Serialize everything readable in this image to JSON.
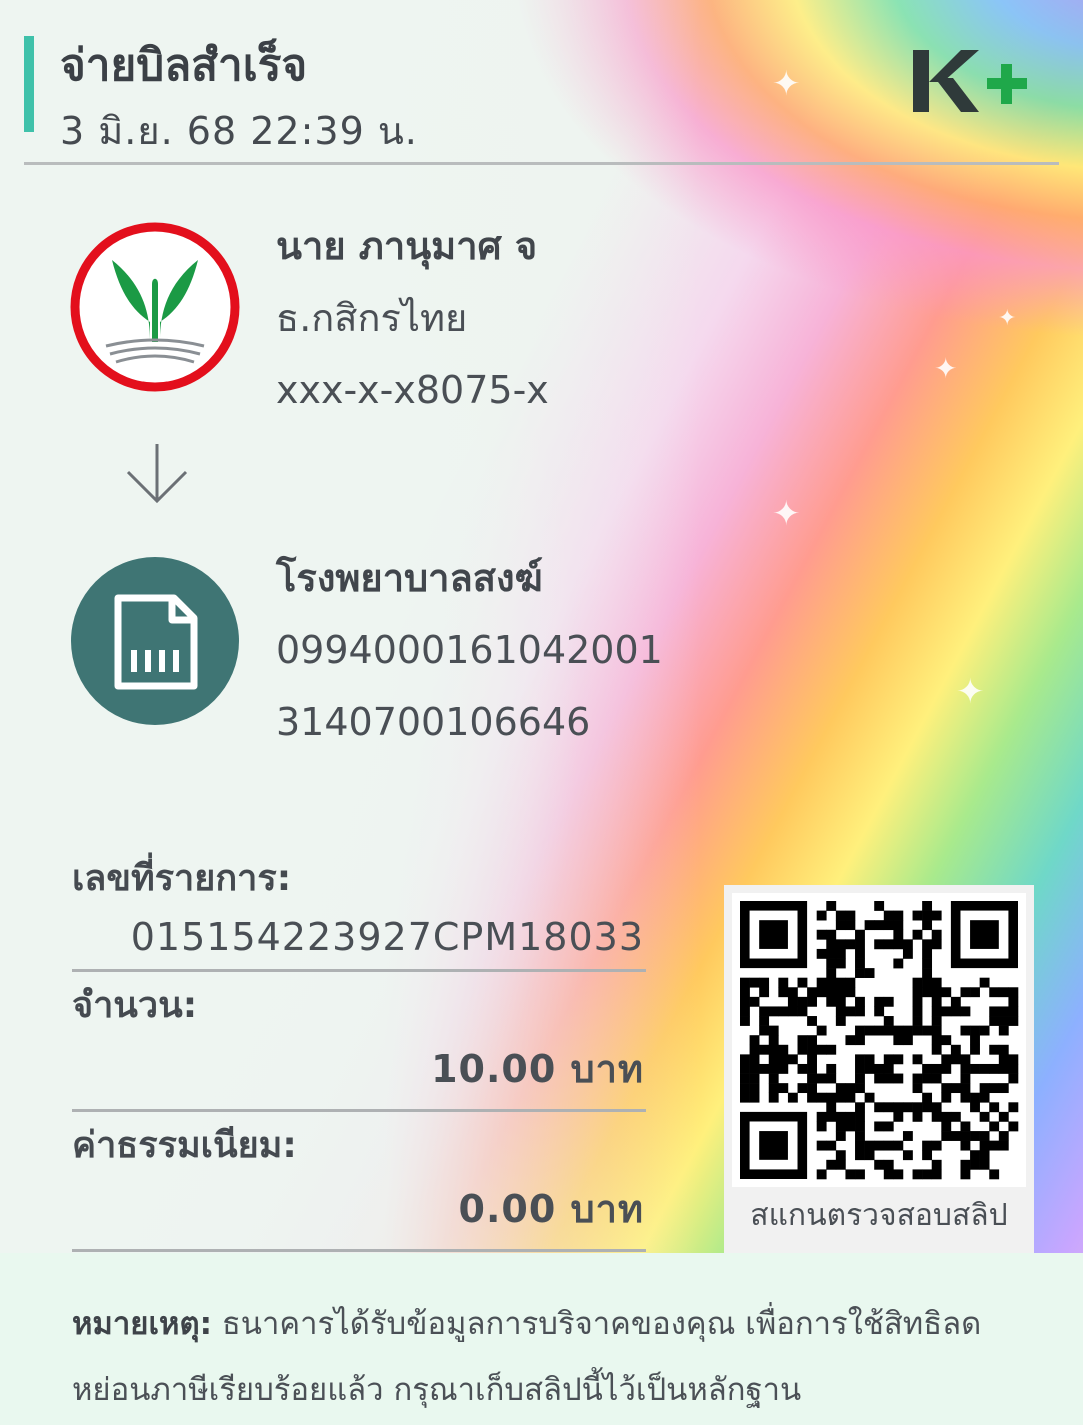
{
  "header": {
    "title": "จ่ายบิลสำเร็จ",
    "datetime": "3 มิ.ย. 68  22:39 น.",
    "brand": "K+",
    "brand_colors": {
      "k": "#2f3a3a",
      "plus": "#1fa84a",
      "accent": "#3fc1aa"
    }
  },
  "sender": {
    "name": "นาย ภานุมาศ จ",
    "bank": "ธ.กสิกรไทย",
    "account": "xxx-x-x8075-x",
    "icon": "kbank-logo-icon"
  },
  "receiver": {
    "name": "โรงพยาบาลสงฆ์",
    "ref1": "0994000161042001",
    "ref2": "3140700106646",
    "icon": "bill-document-icon"
  },
  "details": {
    "transaction_label": "เลขที่รายการ:",
    "transaction_value": "015154223927CPM18033",
    "amount_label": "จำนวน:",
    "amount_value": "10.00 บาท",
    "fee_label": "ค่าธรรมเนียม:",
    "fee_value": "0.00 บาท"
  },
  "qr": {
    "caption": "สแกนตรวจสอบสลิป"
  },
  "note": {
    "label": "หมายเหตุ:",
    "text": " ธนาคารได้รับข้อมูลการบริจาคของคุณ เพื่อการใช้สิทธิลดหย่อนภาษีเรียบร้อยแล้ว กรุณาเก็บสลิปนี้ไว้เป็นหลักฐาน"
  }
}
